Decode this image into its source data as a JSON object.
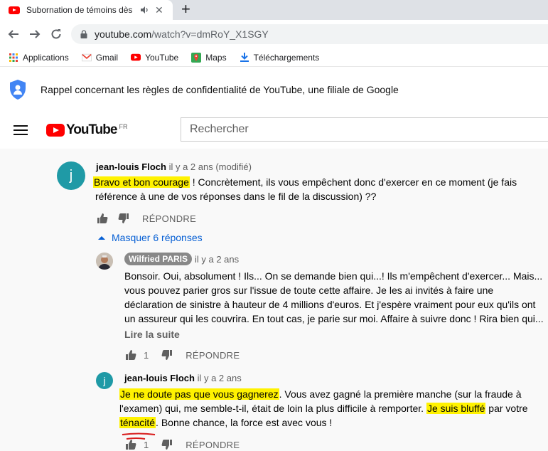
{
  "browser": {
    "tab_title": "Subornation de témoins dès",
    "url_host": "youtube.com",
    "url_path": "/watch?v=dmRoY_X1SGY",
    "bookmarks": [
      "Applications",
      "Gmail",
      "YouTube",
      "Maps",
      "Téléchargements"
    ]
  },
  "banner": {
    "text": "Rappel concernant les règles de confidentialité de YouTube, une filiale de Google"
  },
  "header": {
    "logo_text": "YouTube",
    "region": "FR",
    "search_placeholder": "Rechercher"
  },
  "comments": {
    "top": {
      "avatar_letter": "j",
      "author": "jean-louis Floch",
      "time": "il y a 2 ans (modifié)",
      "text_hl": "Bravo et bon courage",
      "text_rest1": " ! Concrètement, ils vous empêchent donc d'exercer en ce moment (je fais",
      "text_line2": "référence à une de vos réponses dans le fil de la discussion) ??",
      "reply_label": "RÉPONDRE"
    },
    "replies_toggle": "Masquer 6 réponses",
    "reply1": {
      "author": "Wilfried PARIS",
      "time": "il y a 2 ans",
      "lines": [
        "Bonsoir. Oui, absolument ! Ils... On se demande bien qui...! Ils m'empêchent d'exercer... Mais...",
        "vous pouvez parier gros sur l'issue de toute cette affaire. Je les ai invités à faire une",
        "déclaration de sinistre à hauteur de 4 millions d'euros. Et j'espère vraiment pour eux qu'ils ont",
        "un assureur qui les couvrira. En tout cas, je parie sur moi. Affaire à suivre donc ! Rira bien qui..."
      ],
      "read_more": "Lire la suite",
      "likes": "1",
      "reply_label": "RÉPONDRE"
    },
    "reply2": {
      "avatar_letter": "j",
      "author": "jean-louis Floch",
      "time": "il y a 2 ans",
      "l1_hl": "Je ne doute pas que vous gagnerez",
      "l1_rest": ". Vous avez gagné la première manche (sur la fraude à",
      "l2_a": "l'examen) qui, me semble-t-il, était de loin la plus difficile à remporter. ",
      "l2_hl": "Je suis bluffé",
      "l2_b": " par votre",
      "l3_hl": "ténacité",
      "l3_rest": ". Bonne chance, la force est avec vous !",
      "likes": "1",
      "reply_label": "RÉPONDRE"
    }
  },
  "colors": {
    "highlight": "#fff200",
    "link_blue": "#065fd4",
    "avatar_teal": "#1f9aa6",
    "yt_red": "#ff0000"
  }
}
